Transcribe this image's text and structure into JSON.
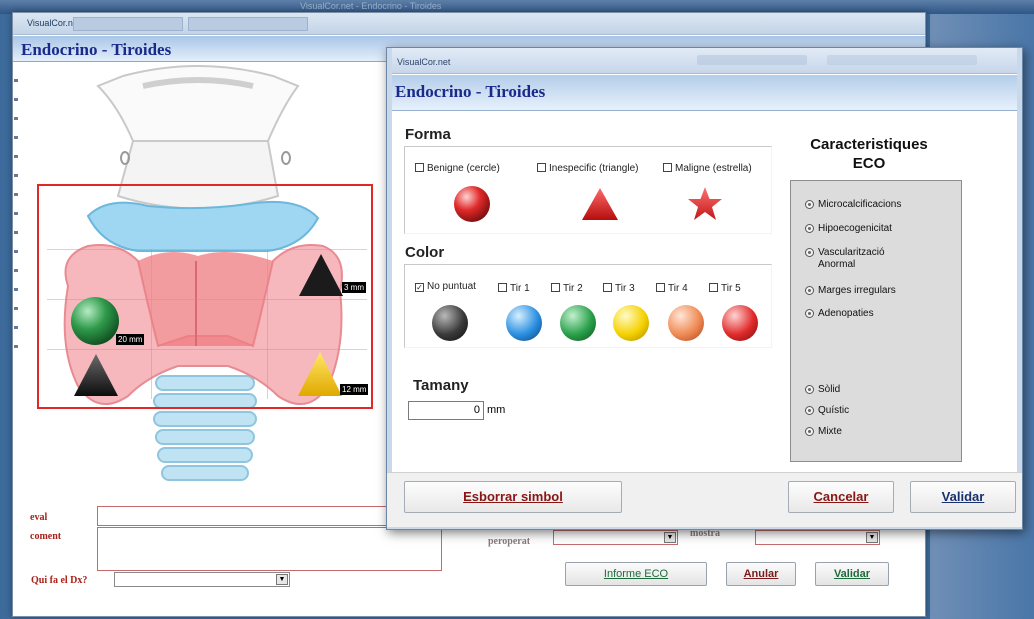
{
  "desktop": {
    "blurred_title": "VisualCor.net - Endocrino - Tiroides"
  },
  "background_window": {
    "title": "VisualCor.net",
    "header": "Endocrino - Tiroides",
    "markers": [
      {
        "shape": "triangle",
        "color": "#1b1b1b",
        "label": "3 mm"
      },
      {
        "shape": "circle",
        "color": "#2f9a4a",
        "label": "20 mm"
      },
      {
        "shape": "triangle",
        "color": "#1b1b1b",
        "label": ""
      },
      {
        "shape": "triangle",
        "color": "#f2c200",
        "label": "12 mm"
      }
    ],
    "form": {
      "eval_label": "eval",
      "coment_label": "coment",
      "qui_label": "Qui fa el Dx?",
      "peroperat_label": "peroperat",
      "mostra_label": "mostra"
    },
    "buttons": {
      "informe": "Informe ECO",
      "anular": "Anular",
      "validar": "Validar"
    }
  },
  "dialog": {
    "title": "VisualCor.net",
    "header": "Endocrino - Tiroides",
    "forma": {
      "title": "Forma",
      "options": [
        {
          "label": "Benigne (cercle)",
          "checked": false
        },
        {
          "label": "Inespecific (triangle)",
          "checked": false
        },
        {
          "label": "Maligne (estrella)",
          "checked": false
        }
      ]
    },
    "color": {
      "title": "Color",
      "options": [
        {
          "label": "No puntuat",
          "checked": true,
          "color": "#3a3a3a"
        },
        {
          "label": "Tir 1",
          "checked": false,
          "color": "#2b8fe0"
        },
        {
          "label": "Tir 2",
          "checked": false,
          "color": "#2aa04a"
        },
        {
          "label": "Tir 3",
          "checked": false,
          "color": "#f5d100"
        },
        {
          "label": "Tir 4",
          "checked": false,
          "color": "#f08a55"
        },
        {
          "label": "Tir 5",
          "checked": false,
          "color": "#e02a2a"
        }
      ]
    },
    "tamany": {
      "title": "Tamany",
      "value": "0",
      "unit": "mm"
    },
    "caracteristiques": {
      "title_line1": "Caracteristiques",
      "title_line2": "ECO",
      "options": [
        "Microcalcificacions",
        "Hipoecogenicitat",
        "Vascularització Anormal",
        "Marges irregulars",
        "Adenopaties"
      ],
      "consistency": [
        "Sòlid",
        "Quístic",
        "Mixte"
      ]
    },
    "buttons": {
      "esborrar": "Esborrar simbol",
      "cancelar": "Cancelar",
      "validar": "Validar"
    }
  }
}
